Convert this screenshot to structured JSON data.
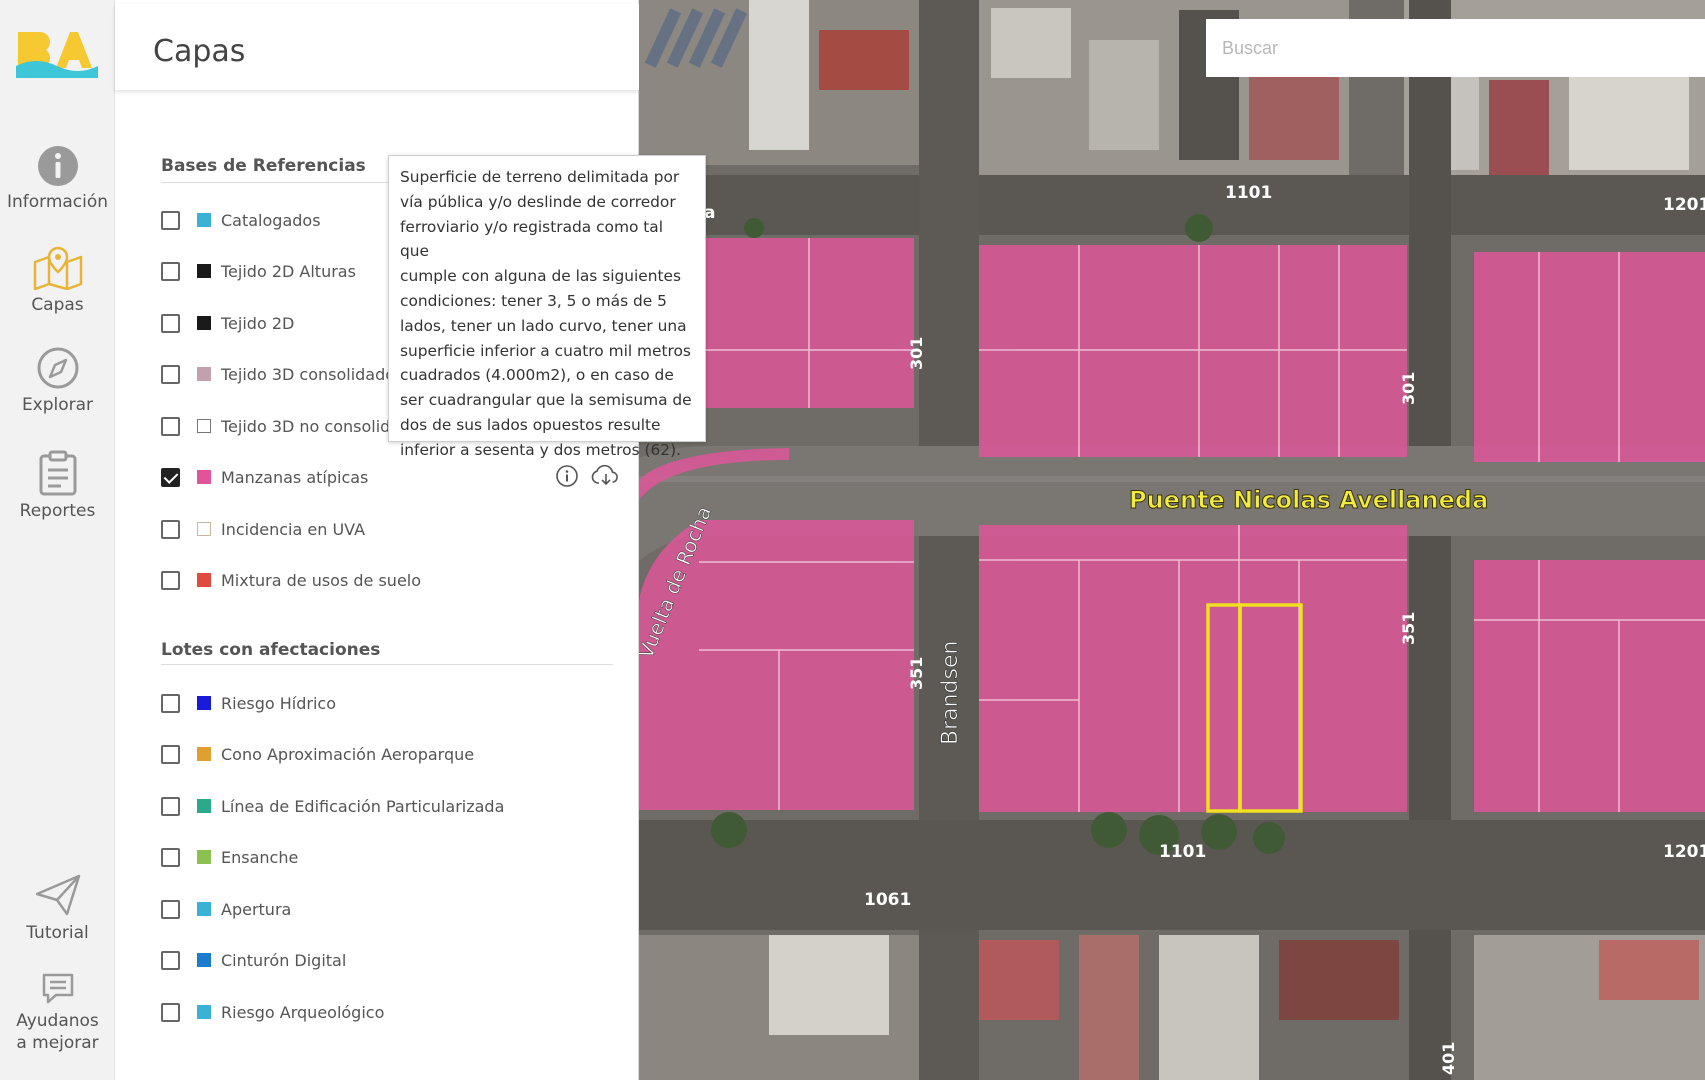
{
  "rail": {
    "items": [
      {
        "label": "Información",
        "icon": "info-icon"
      },
      {
        "label": "Capas",
        "icon": "map-layers-icon"
      },
      {
        "label": "Explorar",
        "icon": "compass-icon"
      },
      {
        "label": "Reportes",
        "icon": "clipboard-icon"
      },
      {
        "label": "Tutorial",
        "icon": "paper-plane-icon"
      },
      {
        "label": "Ayudanos a mejorar",
        "icon": "feedback-icon"
      }
    ],
    "active": "Capas"
  },
  "panel": {
    "title": "Capas",
    "sections": [
      {
        "title": "Bases de Referencias",
        "layers": [
          {
            "label": "Catalogados",
            "color": "#3ab2d6",
            "checked": false
          },
          {
            "label": "Tejido 2D Alturas",
            "color": "#1a1a1a",
            "checked": false
          },
          {
            "label": "Tejido 2D",
            "color": "#1a1a1a",
            "checked": false
          },
          {
            "label": "Tejido 3D consolidado",
            "color": "#c2a0ad",
            "checked": false
          },
          {
            "label": "Tejido 3D no consolidado",
            "color": "#ffffff",
            "checked": false
          },
          {
            "label": "Manzanas atípicas",
            "color": "#e0559a",
            "checked": true
          },
          {
            "label": "Incidencia en UVA",
            "color": "#ffffff",
            "checked": false
          },
          {
            "label": "Mixtura de usos de suelo",
            "color": "#e04a3f",
            "checked": false
          }
        ]
      },
      {
        "title": "Lotes con afectaciones",
        "layers": [
          {
            "label": "Riesgo Hídrico",
            "color": "#1a1adb",
            "checked": false
          },
          {
            "label": "Cono Aproximación Aeroparque",
            "color": "#e0a030",
            "checked": false
          },
          {
            "label": "Línea de Edificación Particularizada",
            "color": "#2aaa8a",
            "checked": false
          },
          {
            "label": "Ensanche",
            "color": "#8cc152",
            "checked": false
          },
          {
            "label": "Apertura",
            "color": "#3ab2d6",
            "checked": false
          },
          {
            "label": "Cinturón Digital",
            "color": "#1c7dcc",
            "checked": false
          },
          {
            "label": "Riesgo Arqueológico",
            "color": "#3ab2d6",
            "checked": false
          }
        ]
      }
    ]
  },
  "tooltip": {
    "lines": [
      "Superficie de terreno delimitada por",
      "vía pública y/o deslinde de corredor",
      "ferroviario y/o registrada como tal que",
      "cumple con alguna de las siguientes",
      "condiciones: tener 3, 5 o más de 5",
      "lados, tener un lado curvo, tener una",
      "superficie inferior a cuatro mil metros",
      "cuadrados (4.000m2), o en caso de",
      "ser cuadrangular que la semisuma de",
      "dos de sus lados opuestos resulte",
      "inferior a sesenta y dos metros (62)."
    ]
  },
  "search": {
    "placeholder": "Buscar",
    "value": ""
  },
  "map": {
    "labels": {
      "bridge": "Puente Nicolas Avellaneda",
      "street": "Brandsen",
      "curved": "Vuelta de Rocha",
      "n1101_top": "1101",
      "n1201_top": "1201",
      "n301_left": "301",
      "n301_right": "301",
      "n351_left": "351",
      "n351_right": "351",
      "n1101_bottom": "1101",
      "n1201_bottom": "1201",
      "n1061": "1061",
      "n401": "401",
      "n_a": "a"
    },
    "highlight_color": "#e0559a",
    "selection_color": "#f0e020"
  }
}
